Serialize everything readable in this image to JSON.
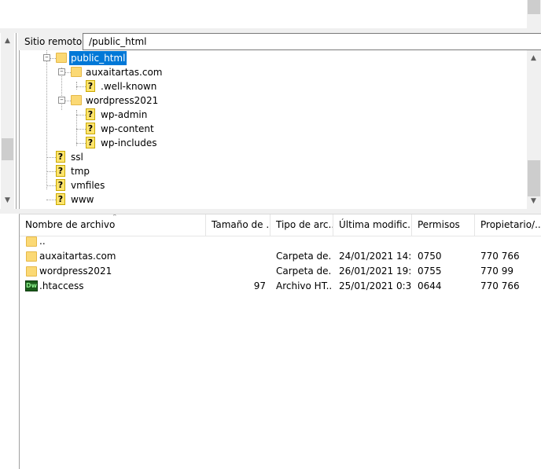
{
  "remote_bar": {
    "label": "Sitio remoto:",
    "path": "/public_html"
  },
  "tree": {
    "nodes": [
      {
        "label": "public_html",
        "icon": "folder-icon",
        "selected": true
      },
      {
        "label": "auxaitartas.com",
        "icon": "folder-icon"
      },
      {
        "label": ".well-known",
        "icon": "unknown-folder-icon"
      },
      {
        "label": "wordpress2021",
        "icon": "folder-icon"
      },
      {
        "label": "wp-admin",
        "icon": "unknown-folder-icon"
      },
      {
        "label": "wp-content",
        "icon": "unknown-folder-icon"
      },
      {
        "label": "wp-includes",
        "icon": "unknown-folder-icon"
      },
      {
        "label": "ssl",
        "icon": "unknown-folder-icon"
      },
      {
        "label": "tmp",
        "icon": "unknown-folder-icon"
      },
      {
        "label": "vmfiles",
        "icon": "unknown-folder-icon"
      },
      {
        "label": "www",
        "icon": "unknown-folder-icon"
      }
    ]
  },
  "file_list": {
    "columns": [
      "Nombre de archivo",
      "Tamaño de ...",
      "Tipo de arc...",
      "Última modific...",
      "Permisos",
      "Propietario/..."
    ],
    "rows": [
      {
        "name": "..",
        "size": "",
        "type": "",
        "modified": "",
        "perms": "",
        "owner": "",
        "icon": "folder-icon"
      },
      {
        "name": "auxaitartas.com",
        "size": "",
        "type": "Carpeta de...",
        "modified": "24/01/2021 14:...",
        "perms": "0750",
        "owner": "770 766",
        "icon": "folder-icon"
      },
      {
        "name": "wordpress2021",
        "size": "",
        "type": "Carpeta de...",
        "modified": "26/01/2021 19:...",
        "perms": "0755",
        "owner": "770 99",
        "icon": "folder-icon"
      },
      {
        "name": ".htaccess",
        "size": "97",
        "type": "Archivo HT...",
        "modified": "25/01/2021 0:3...",
        "perms": "0644",
        "owner": "770 766",
        "icon": "dreamweaver-file-icon"
      }
    ]
  },
  "icons": {
    "dw_text": "Dw"
  },
  "colors": {
    "selection": "#0078d7",
    "folder": "#fbd975"
  }
}
